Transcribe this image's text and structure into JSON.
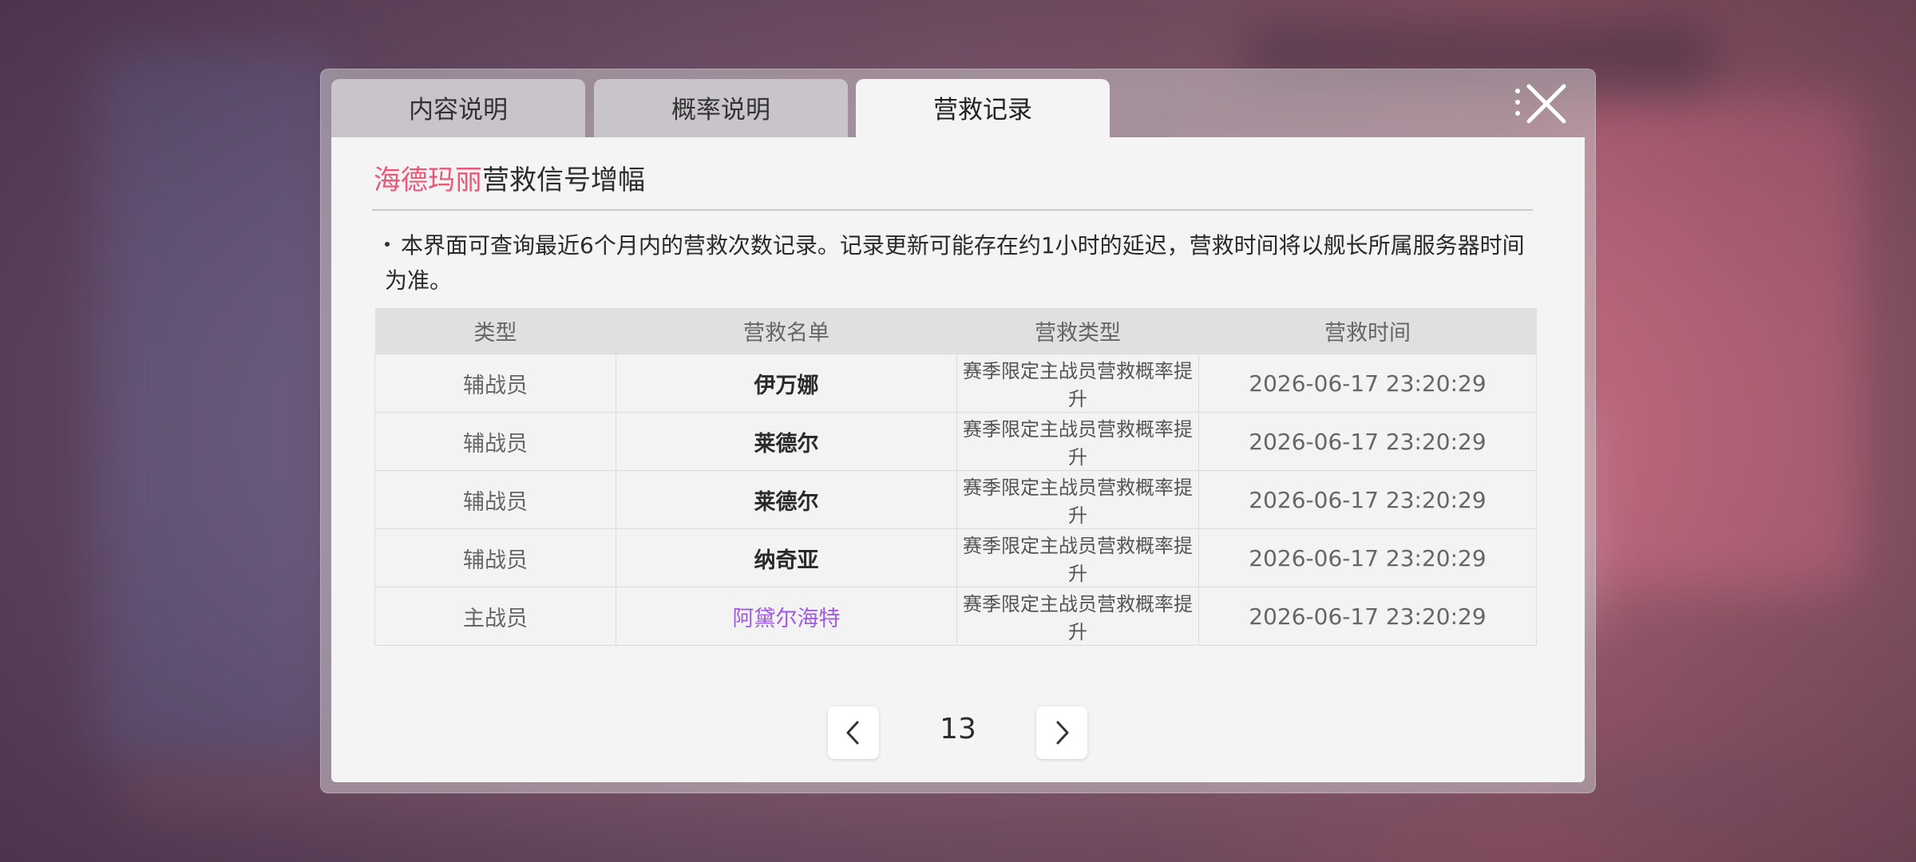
{
  "tabs": [
    {
      "label": "内容说明"
    },
    {
      "label": "概率说明"
    },
    {
      "label": "营救记录"
    }
  ],
  "active_tab": "营救记录",
  "title": {
    "highlight": "海德玛丽",
    "rest": "营救信号增幅"
  },
  "notice": "本界面可查询最近6个月内的营救次数记录。记录更新可能存在约1小时的延迟，营救时间将以舰长所属服务器时间为准。",
  "table": {
    "headers": [
      "类型",
      "营救名单",
      "营救类型",
      "营救时间"
    ],
    "rows": [
      {
        "type": "辅战员",
        "name": "伊万娜",
        "reason": "赛季限定主战员营救概率提升",
        "time": "2026-06-17 23:20:29"
      },
      {
        "type": "辅战员",
        "name": "莱德尔",
        "reason": "赛季限定主战员营救概率提升",
        "time": "2026-06-17 23:20:29"
      },
      {
        "type": "辅战员",
        "name": "莱德尔",
        "reason": "赛季限定主战员营救概率提升",
        "time": "2026-06-17 23:20:29"
      },
      {
        "type": "辅战员",
        "name": "纳奇亚",
        "reason": "赛季限定主战员营救概率提升",
        "time": "2026-06-17 23:20:29"
      },
      {
        "type": "主战员",
        "name": "阿黛尔海特",
        "reason": "赛季限定主战员营救概率提升",
        "time": "2026-06-17 23:20:29"
      }
    ]
  },
  "pagination": {
    "page": "13"
  },
  "colors": {
    "highlight": "#e8587a",
    "rare_name": "#a15ae0",
    "panel": "#f4f4f4"
  },
  "icons": {
    "close": "close-icon",
    "prev": "chevron-left-icon",
    "next": "chevron-right-icon",
    "menu": "more-dots-icon"
  }
}
